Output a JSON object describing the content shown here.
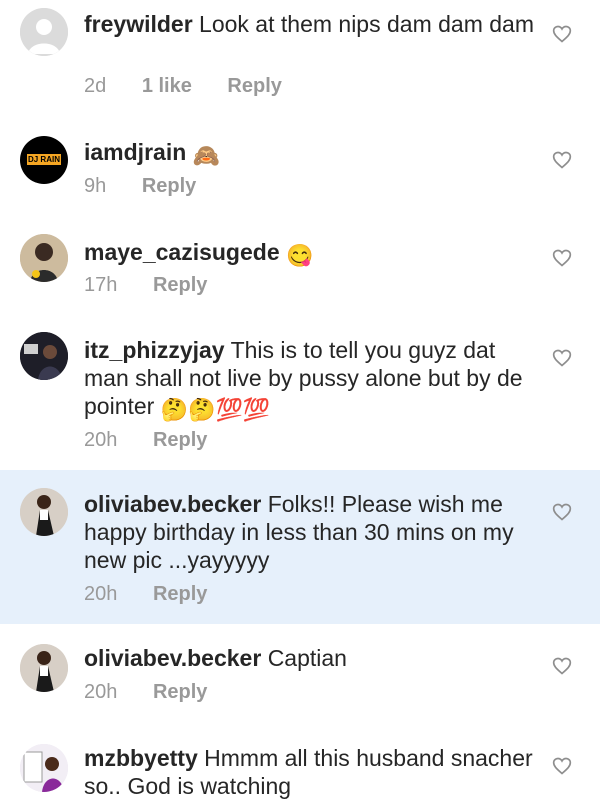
{
  "comments": [
    {
      "username": "freywilder",
      "text": "Look at them nips dam dam dam",
      "time": "2d",
      "likes": "1 like",
      "reply": "Reply"
    },
    {
      "username": "iamdjrain",
      "text": "🙈",
      "time": "9h",
      "reply": "Reply",
      "avatar_label": "DJ RAIN"
    },
    {
      "username": "maye_cazisugede",
      "text": "😋",
      "time": "17h",
      "reply": "Reply"
    },
    {
      "username": "itz_phizzyjay",
      "text": "This is to tell you guyz dat man shall not live by pussy alone but by de pointer",
      "emoji_tail": "🤔🤔💯💯",
      "time": "20h",
      "reply": "Reply"
    },
    {
      "username": "oliviabev.becker",
      "text": "Folks!! Please wish me happy birthday in less than 30 mins on my new pic ...yayyyyy",
      "time": "20h",
      "reply": "Reply"
    },
    {
      "username": "oliviabev.becker",
      "text": "Captian",
      "time": "20h",
      "reply": "Reply"
    },
    {
      "username": "mzbbyetty",
      "text": "Hmmm all this husband snacher so.. God is watching",
      "time": "",
      "reply": ""
    }
  ],
  "colors": {
    "highlight_bg": "#e6f0fb",
    "meta_text": "#999999",
    "heart_stroke": "#8e8e8e"
  },
  "icons": {
    "like": "heart-outline-icon"
  }
}
